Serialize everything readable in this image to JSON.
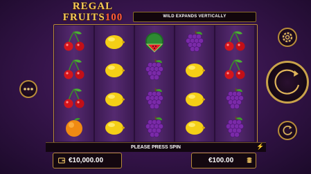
{
  "logo": {
    "line1": "REGAL",
    "line2": "FRUITS",
    "line2_num": "100"
  },
  "banner_text": "WILD EXPANDS VERTICALLY",
  "status_text": "PLEASE PRESS SPIN",
  "balance": {
    "value": "€10,000.00",
    "icon": "wallet-icon"
  },
  "bet": {
    "value": "€100.00",
    "icon": "coins-icon"
  },
  "reels": [
    [
      "cherry",
      "cherry",
      "cherry",
      "orange"
    ],
    [
      "lemon",
      "lemon",
      "lemon",
      "lemon"
    ],
    [
      "watermelon",
      "grapes",
      "grapes",
      "grapes"
    ],
    [
      "grapes",
      "lemon",
      "lemon",
      "lemon"
    ],
    [
      "cherry",
      "cherry",
      "grapes",
      "grapes"
    ]
  ],
  "buttons": {
    "settings": "gear-icon",
    "menu": "more-icon",
    "spin": "spin-icon",
    "autoplay": "autoplay-icon"
  },
  "colors": {
    "gold": "#c9a24a",
    "background": "#3a1650"
  }
}
